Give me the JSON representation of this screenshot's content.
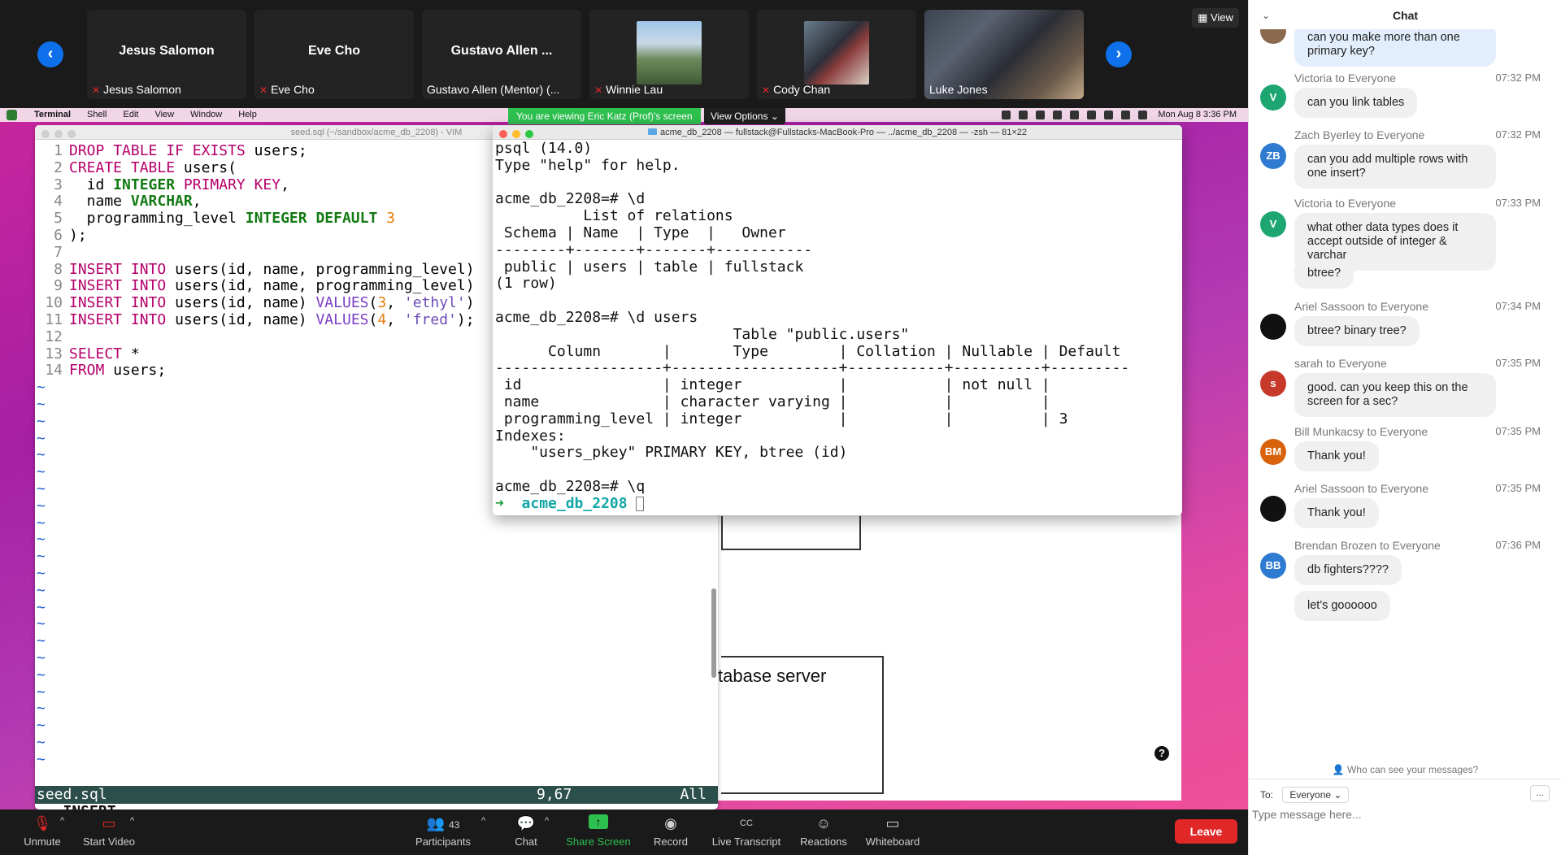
{
  "top": {
    "participants": [
      {
        "display": "Jesus Salomon",
        "label": "Jesus Salomon",
        "muted": true
      },
      {
        "display": "Eve Cho",
        "label": "Eve Cho",
        "muted": true
      },
      {
        "display": "Gustavo Allen ...",
        "label": "Gustavo Allen (Mentor) (...",
        "muted": false
      },
      {
        "label": "Winnie Lau",
        "muted": true
      },
      {
        "label": "Cody Chan",
        "muted": true
      },
      {
        "label": "Luke Jones",
        "muted": false
      }
    ],
    "view_label": "View"
  },
  "share": {
    "viewing_banner": "You are viewing Eric Katz (Prof)'s screen",
    "view_options": "View Options"
  },
  "mac": {
    "menus": [
      "Terminal",
      "Shell",
      "Edit",
      "View",
      "Window",
      "Help"
    ],
    "clock": "Mon Aug 8  3:36 PM"
  },
  "vim": {
    "title": "seed.sql (~/sandbox/acme_db_2208) - VIM",
    "lines": [
      "DROP TABLE IF EXISTS users;",
      "CREATE TABLE users(",
      "  id INTEGER PRIMARY KEY,",
      "  name VARCHAR,",
      "  programming_level INTEGER DEFAULT 3",
      ");",
      "",
      "INSERT INTO users(id, name, programming_level)",
      "INSERT INTO users(id, name, programming_level)",
      "INSERT INTO users(id, name) VALUES(3, 'ethyl')",
      "INSERT INTO users(id, name) VALUES(4, 'fred');",
      "",
      "SELECT *",
      "FROM users;"
    ],
    "status_file": "seed.sql",
    "status_pos": "9,67",
    "status_all": "All",
    "mode": "-- INSERT --"
  },
  "diagram": {
    "server_label": "tabase server",
    "help": "?"
  },
  "terminal": {
    "title": "acme_db_2208 — fullstack@Fullstacks-MacBook-Pro — ../acme_db_2208 — -zsh — 81×22",
    "output": "psql (14.0)\nType \"help\" for help.\n\nacme_db_2208=# \\d\n          List of relations\n Schema | Name  | Type  |   Owner\n--------+-------+-------+-----------\n public | users | table | fullstack\n(1 row)\n\nacme_db_2208=# \\d users\n                           Table \"public.users\"\n      Column       |       Type        | Collation | Nullable | Default\n-------------------+-------------------+-----------+----------+---------\n id                | integer           |           | not null |\n name              | character varying |           |          |\n programming_level | integer           |           |          | 3\nIndexes:\n    \"users_pkey\" PRIMARY KEY, btree (id)\n\nacme_db_2208=# \\q",
    "prompt_arrow": "➜",
    "prompt_dir": "acme_db_2208"
  },
  "toolbar": {
    "unmute": "Unmute",
    "start_video": "Start Video",
    "participants": "Participants",
    "participants_count": "43",
    "chat": "Chat",
    "share_screen": "Share Screen",
    "record": "Record",
    "live_transcript": "Live Transcript",
    "reactions": "Reactions",
    "whiteboard": "Whiteboard",
    "leave": "Leave",
    "cc": "CC"
  },
  "chat": {
    "title": "Chat",
    "messages": [
      {
        "sender": "",
        "time": "",
        "text": "can you make more than one primary key?",
        "initials": ""
      },
      {
        "sender": "Victoria to Everyone",
        "time": "07:32 PM",
        "text": "can you link tables",
        "initials": "V",
        "color": "#1ea672"
      },
      {
        "sender": "Zach Byerley to Everyone",
        "time": "07:32 PM",
        "text": "can you add multiple rows with one insert?",
        "initials": "ZB",
        "color": "#2f7bd1"
      },
      {
        "sender": "Victoria to Everyone",
        "time": "07:33 PM",
        "text": "what other data types does it accept outside of integer & varchar",
        "initials": "V",
        "color": "#1ea672"
      },
      {
        "sender": "",
        "time": "",
        "text": "btree?",
        "initials": ""
      },
      {
        "sender": "Ariel Sassoon to Everyone",
        "time": "07:34 PM",
        "text": "btree? binary tree?",
        "initials": "",
        "color": "#111111"
      },
      {
        "sender": "sarah to Everyone",
        "time": "07:35 PM",
        "text": "good. can you keep this on the screen for a sec?",
        "initials": "s",
        "color": "#c73a2b"
      },
      {
        "sender": "Bill Munkacsy to Everyone",
        "time": "07:35 PM",
        "text": "Thank you!",
        "initials": "BM",
        "color": "#d9630c"
      },
      {
        "sender": "Ariel Sassoon to Everyone",
        "time": "07:35 PM",
        "text": "Thank you!",
        "initials": "",
        "color": "#111111"
      },
      {
        "sender": "Brendan Brozen to Everyone",
        "time": "07:36 PM",
        "text": "db fighters????",
        "initials": "BB",
        "color": "#2f7bd1"
      },
      {
        "sender": "",
        "time": "",
        "text": "let's goooooo",
        "initials": ""
      }
    ],
    "who_can_see": "Who can see your messages?",
    "to_label": "To:",
    "to_value": "Everyone",
    "more": "...",
    "input_placeholder": "Type message here..."
  }
}
